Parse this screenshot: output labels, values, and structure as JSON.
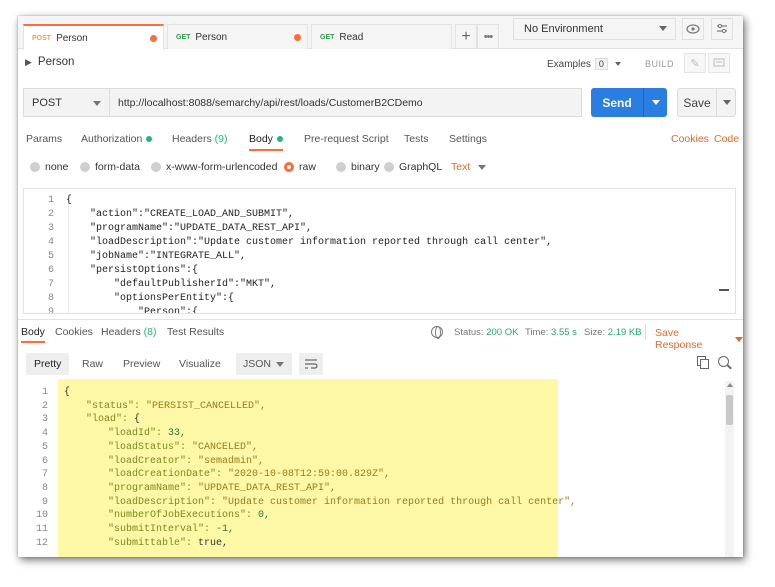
{
  "tabs": [
    {
      "method": "POST",
      "label": "Person",
      "active": true
    },
    {
      "method": "GET",
      "label": "Person",
      "active": false
    },
    {
      "method": "GET",
      "label": "Read",
      "active": false
    }
  ],
  "environment": {
    "selected": "No Environment"
  },
  "request": {
    "name": "Person",
    "examples_label": "Examples",
    "examples_count": "0",
    "build_label": "BUILD",
    "method": "POST",
    "url": "http://localhost:8088/semarchy/api/rest/loads/CustomerB2CDemo",
    "send_label": "Send",
    "save_label": "Save"
  },
  "request_tabs": {
    "params": "Params",
    "authorization": "Authorization",
    "headers": "Headers",
    "headers_count": "(9)",
    "body": "Body",
    "prerequest": "Pre-request Script",
    "tests": "Tests",
    "settings": "Settings",
    "cookies": "Cookies",
    "code": "Code"
  },
  "body_types": {
    "none": "none",
    "form_data": "form-data",
    "urlencoded": "x-www-form-urlencoded",
    "raw": "raw",
    "binary": "binary",
    "graphql": "GraphQL",
    "text_type": "Text"
  },
  "request_body": [
    {
      "n": "1",
      "text": "{"
    },
    {
      "n": "2",
      "text": "    \"action\":\"CREATE_LOAD_AND_SUBMIT\","
    },
    {
      "n": "3",
      "text": "    \"programName\":\"UPDATE_DATA_REST_API\","
    },
    {
      "n": "4",
      "text": "    \"loadDescription\":\"Update customer information reported through call center\","
    },
    {
      "n": "5",
      "text": "    \"jobName\":\"INTEGRATE_ALL\","
    },
    {
      "n": "6",
      "text": "    \"persistOptions\":{"
    },
    {
      "n": "7",
      "text": "        \"defaultPublisherId\":\"MKT\","
    },
    {
      "n": "8",
      "text": "        \"optionsPerEntity\":{"
    },
    {
      "n": "9",
      "text": "            \"Person\":{"
    }
  ],
  "response_tabs": {
    "body": "Body",
    "cookies": "Cookies",
    "headers": "Headers",
    "headers_count": "(8)",
    "test_results": "Test Results"
  },
  "response_status": {
    "status_label": "Status:",
    "status_value": "200 OK",
    "time_label": "Time:",
    "time_value": "3.55 s",
    "size_label": "Size:",
    "size_value": "2.19 KB",
    "save_response": "Save Response"
  },
  "view_modes": {
    "pretty": "Pretty",
    "raw": "Raw",
    "preview": "Preview",
    "visualize": "Visualize",
    "format": "JSON"
  },
  "response_body": [
    {
      "n": "1",
      "key": "",
      "val": "{",
      "vclass": "rb",
      "indent": 0
    },
    {
      "n": "2",
      "key": "\"status\": ",
      "val": "\"PERSIST_CANCELLED\",",
      "vclass": "rs",
      "indent": 1
    },
    {
      "n": "3",
      "key": "\"load\": ",
      "val": "{",
      "vclass": "rb",
      "indent": 1
    },
    {
      "n": "4",
      "key": "\"loadId\": ",
      "val": "33,",
      "vclass": "rn",
      "indent": 2
    },
    {
      "n": "5",
      "key": "\"loadStatus\": ",
      "val": "\"CANCELED\",",
      "vclass": "rs",
      "indent": 2
    },
    {
      "n": "6",
      "key": "\"loadCreator\": ",
      "val": "\"semadmin\",",
      "vclass": "rs",
      "indent": 2
    },
    {
      "n": "7",
      "key": "\"loadCreationDate\": ",
      "val": "\"2020-10-08T12:59:00.829Z\",",
      "vclass": "rs",
      "indent": 2
    },
    {
      "n": "8",
      "key": "\"programName\": ",
      "val": "\"UPDATE_DATA_REST_API\",",
      "vclass": "rs",
      "indent": 2
    },
    {
      "n": "9",
      "key": "\"loadDescription\": ",
      "val": "\"Update customer information reported through call center\",",
      "vclass": "rs",
      "indent": 2
    },
    {
      "n": "10",
      "key": "\"numberOfJobExecutions\": ",
      "val": "0,",
      "vclass": "rn",
      "indent": 2
    },
    {
      "n": "11",
      "key": "\"submitInterval\": ",
      "val": "-1,",
      "vclass": "rn",
      "indent": 2
    },
    {
      "n": "12",
      "key": "\"submittable\": ",
      "val": "true,",
      "vclass": "rb",
      "indent": 2
    }
  ],
  "colors": {
    "accent": "#ff6c37",
    "send": "#2a7de1",
    "success": "#26b47f",
    "highlight": "#fcf8a6"
  }
}
